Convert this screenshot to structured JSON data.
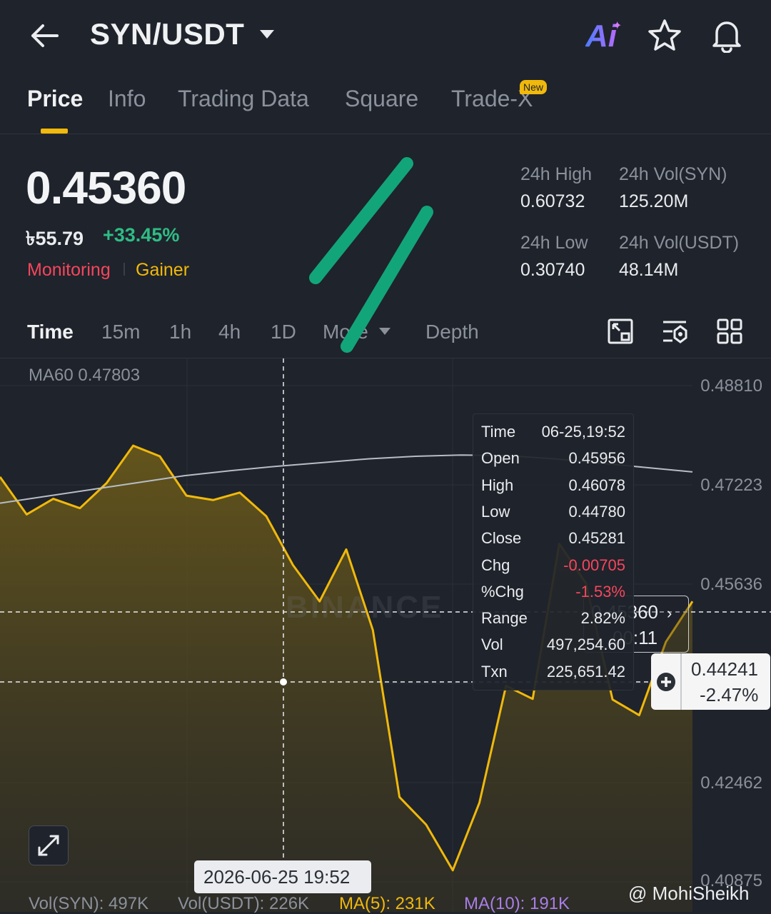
{
  "header": {
    "pair": "SYN/USDT",
    "ai_label": "Ai"
  },
  "tabs": [
    {
      "label": "Price",
      "active": true
    },
    {
      "label": "Info"
    },
    {
      "label": "Trading Data"
    },
    {
      "label": "Square"
    },
    {
      "label": "Trade-X"
    }
  ],
  "new_badge": "New",
  "price": {
    "last": "0.45360",
    "fiat": "৳55.79",
    "change_pct": "+33.45%",
    "tag_monitoring": "Monitoring",
    "tag_gainer": "Gainer"
  },
  "stats": {
    "high_label": "24h High",
    "high_value": "0.60732",
    "vol_syn_label": "24h Vol(SYN)",
    "vol_syn_value": "125.20M",
    "low_label": "24h Low",
    "low_value": "0.30740",
    "vol_usdt_label": "24h Vol(USDT)",
    "vol_usdt_value": "48.14M"
  },
  "intervals": [
    "Time",
    "15m",
    "1h",
    "4h",
    "1D",
    "More",
    "Depth"
  ],
  "chart": {
    "ma60_label": "MA60 0.47803",
    "y_ticks": [
      "0.48810",
      "0.47223",
      "0.45636",
      "0.42462",
      "0.40875"
    ],
    "last_price_tag": "0.45360",
    "last_price_countdown": "00:11",
    "cursor_price": "0.44241",
    "cursor_pct": "-2.47%",
    "cursor_time": "2026-06-25 19:52",
    "watermark": "BINANCE"
  },
  "chart_data": {
    "type": "area",
    "y_range": [
      0.40875,
      0.4881
    ],
    "price_series": {
      "name": "",
      "values": [
        0.4735,
        0.4675,
        0.47,
        0.4685,
        0.4725,
        0.4785,
        0.4768,
        0.4705,
        0.4698,
        0.471,
        0.4672,
        0.4594,
        0.4536,
        0.4619,
        0.449,
        0.4223,
        0.4179,
        0.4106,
        0.4214,
        0.4401,
        0.438,
        0.4628,
        0.4565,
        0.4379,
        0.4354,
        0.4471,
        0.4536
      ]
    },
    "ma60_series": {
      "name": "MA60",
      "values": [
        0.4693,
        0.4704,
        0.4715,
        0.4726,
        0.4737,
        0.4745,
        0.4752,
        0.4758,
        0.4764,
        0.4768,
        0.477,
        0.4769,
        0.4764,
        0.4757,
        0.475,
        0.4743
      ]
    }
  },
  "tooltip": [
    {
      "label": "Time",
      "value": "06-25,19:52"
    },
    {
      "label": "Open",
      "value": "0.45956"
    },
    {
      "label": "High",
      "value": "0.46078"
    },
    {
      "label": "Low",
      "value": "0.44780"
    },
    {
      "label": "Close",
      "value": "0.45281"
    },
    {
      "label": "Chg",
      "value": "-0.00705",
      "neg": true
    },
    {
      "label": "%Chg",
      "value": "-1.53%",
      "neg": true
    },
    {
      "label": "Range",
      "value": "2.82%"
    },
    {
      "label": "Vol",
      "value": "497,254.60"
    },
    {
      "label": "Txn",
      "value": "225,651.42"
    }
  ],
  "volume": {
    "syn": "Vol(SYN): 497K",
    "usdt": "Vol(USDT): 226K",
    "ma5": "MA(5): 231K",
    "ma10": "MA(10): 191K"
  },
  "credit": "@ MohiSheikh",
  "colors": {
    "up": "#2ebd85",
    "down": "#f6465d",
    "accent": "#f0b90b",
    "line": "#f0b90b",
    "ma60": "#b7bdc6",
    "ma10": "#a97ee6"
  }
}
